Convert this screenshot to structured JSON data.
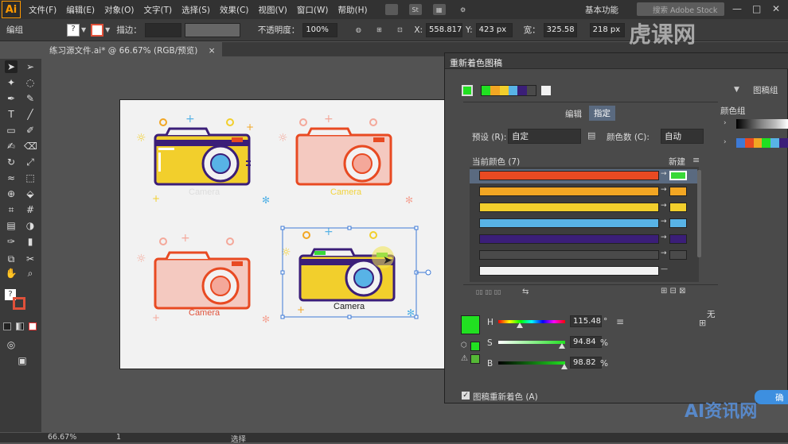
{
  "app": {
    "logo": "Ai"
  },
  "menu": [
    "文件(F)",
    "编辑(E)",
    "对象(O)",
    "文字(T)",
    "选择(S)",
    "效果(C)",
    "视图(V)",
    "窗口(W)",
    "帮助(H)"
  ],
  "menubar": {
    "st_icon": "St",
    "workspace": "基本功能",
    "search_placeholder": "搜索 Adobe Stock"
  },
  "control": {
    "selection_label": "编组",
    "stroke_label": "描边：",
    "opacity_label": "不透明度：",
    "opacity_value": "100%",
    "x_label": "X:",
    "x_value": "558.817",
    "y_label": "Y:",
    "y_value": "423 px",
    "w_label": "宽：",
    "w_value": "325.58",
    "h_value": "218 px"
  },
  "document": {
    "tab_label": "练习源文件.ai* @ 66.67% (RGB/预览)",
    "close": "×"
  },
  "artboard": {
    "cameras": [
      {
        "label": "Camera",
        "label_color": "#222222"
      },
      {
        "label": "Camera",
        "label_color": "#f2d33c"
      },
      {
        "label": "Camera",
        "label_color": "#e0513a"
      },
      {
        "label": "Camera",
        "label_color": "#222222"
      }
    ]
  },
  "status": {
    "zoom": "66.67%",
    "page": "1",
    "tool": "选择"
  },
  "dialog": {
    "title": "重新着色图稿",
    "group_dropdown": "图稿组",
    "tabs": {
      "edit": "编辑",
      "assign": "指定"
    },
    "preset_label": "预设 (R):",
    "preset_value": "自定",
    "colors_label": "颜色数 (C):",
    "colors_value": "自动",
    "current_label": "当前颜色 (7)",
    "new_label": "新建",
    "color_groups_label": "颜色组",
    "none_label": "无",
    "current_colors": [
      "#e84a22",
      "#f2a623",
      "#f2cf2c",
      "#58b3e6",
      "#3b1e78",
      "#4a4a4a",
      "#f2f2f2"
    ],
    "new_colors": [
      "#38d838",
      "#f2a623",
      "#f2cf2c",
      "#58b3e6",
      "#3b1e78",
      "#4a4a4a"
    ],
    "hsb": {
      "h_label": "H",
      "h_value": "115.48",
      "h_unit": "°",
      "h": 115.48,
      "s_label": "S",
      "s_value": "94.84",
      "s_unit": "%",
      "s": 94.84,
      "b_label": "B",
      "b_value": "98.82",
      "b_unit": "%",
      "b": 98.82
    },
    "recolor_checkbox_label": "图稿重新着色 (A)",
    "ok_label": "确"
  },
  "watermarks": {
    "top": "虎课网",
    "bottom": "AI资讯网"
  },
  "colors": {
    "accent": "#21e021",
    "selection": "#3d7ad6"
  }
}
